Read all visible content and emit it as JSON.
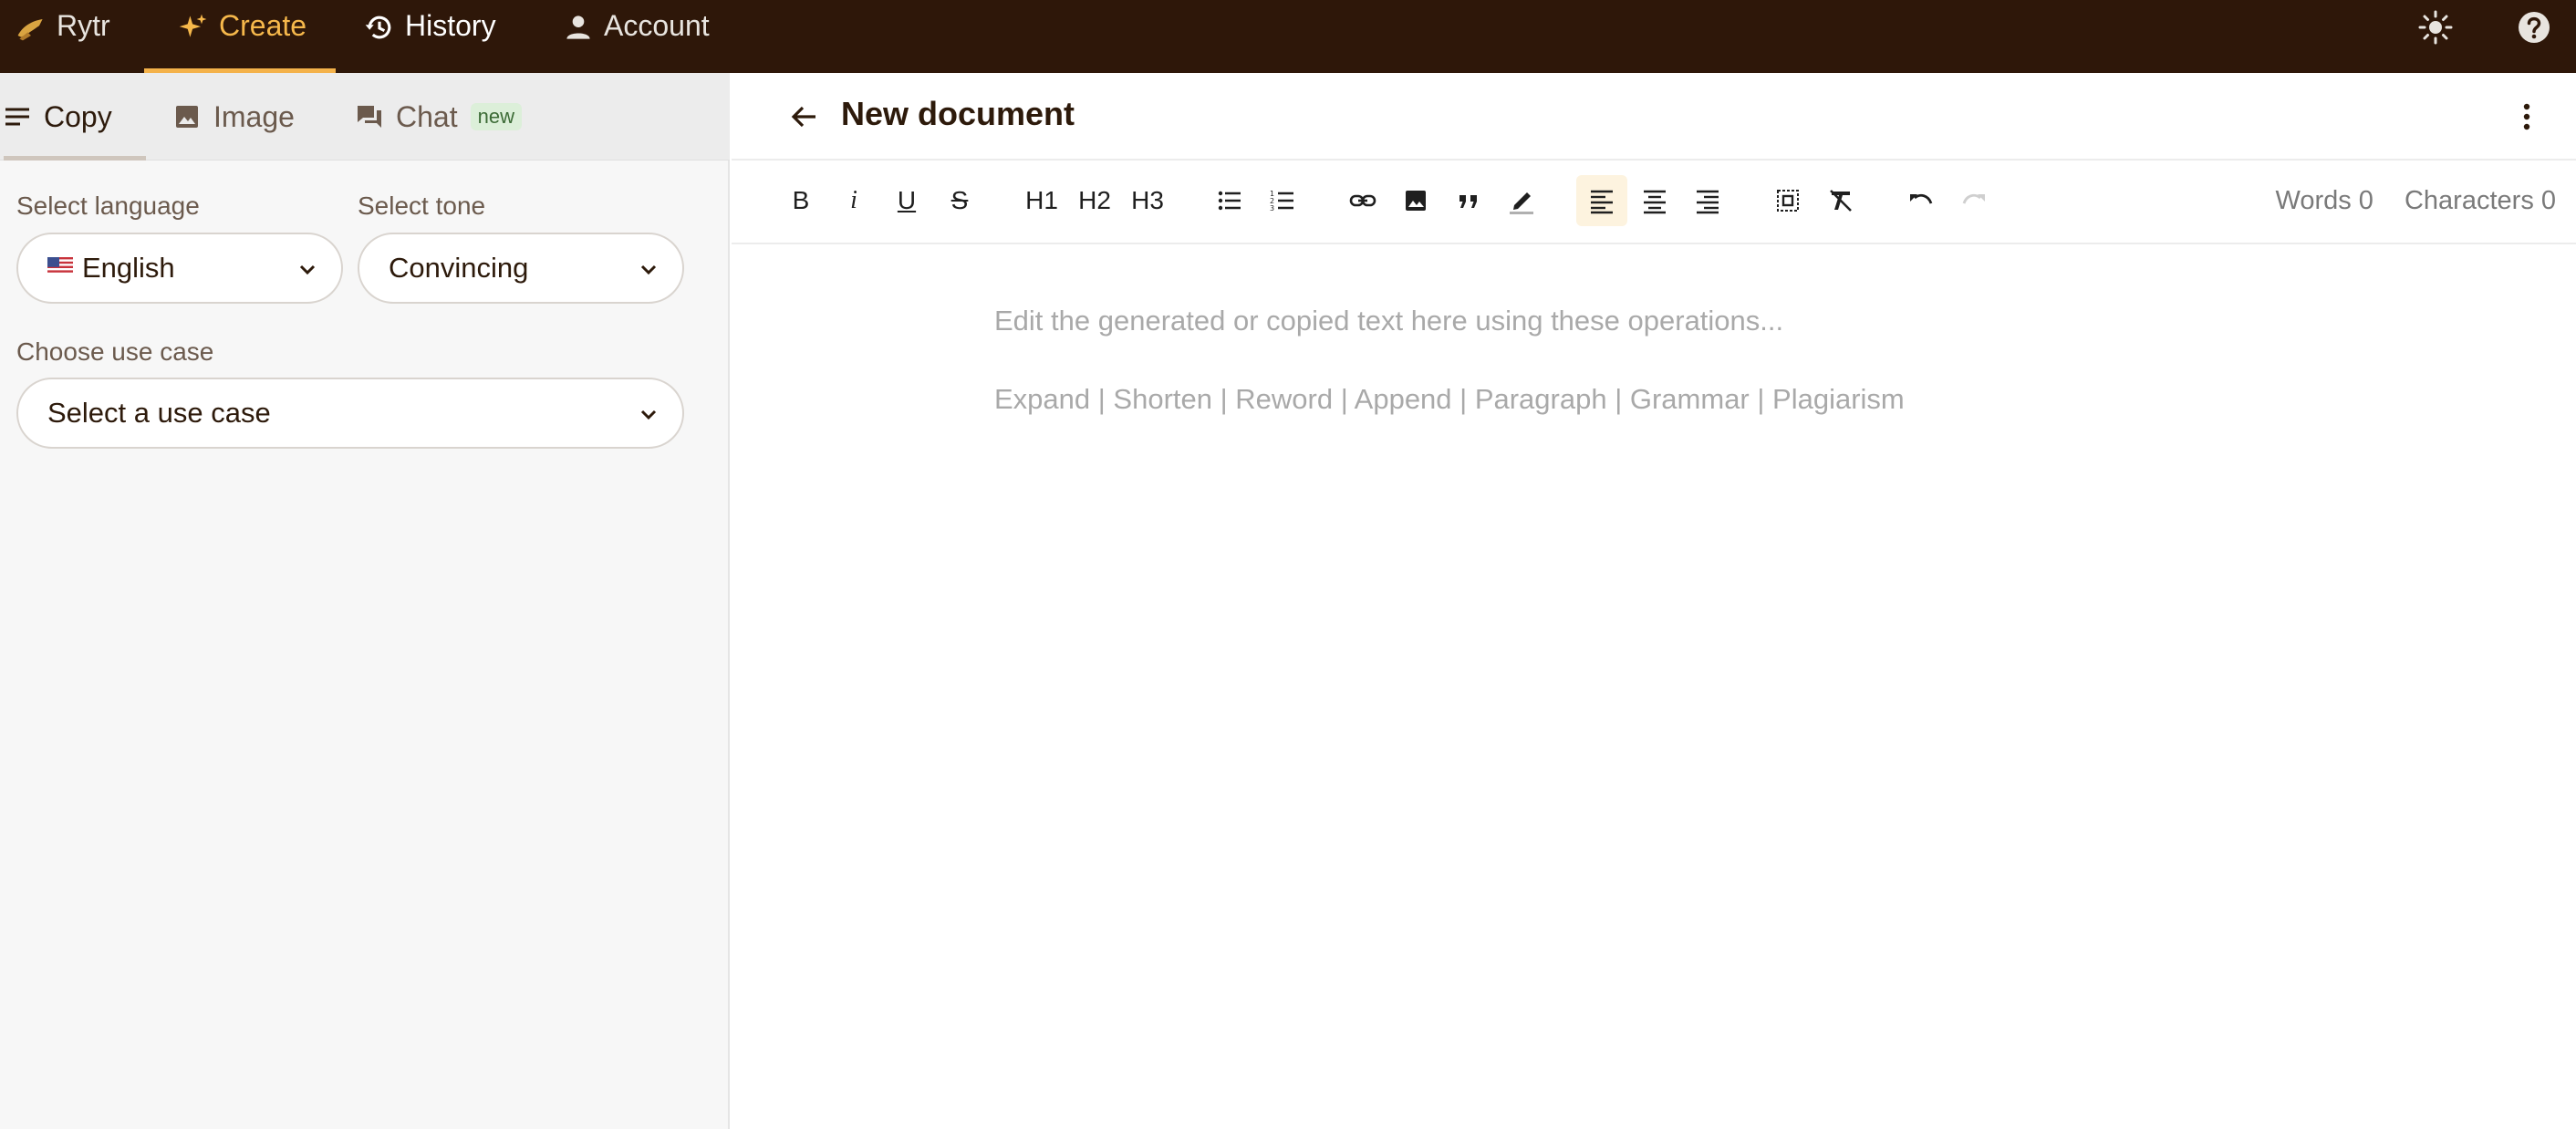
{
  "topnav": {
    "brand": "Rytr",
    "create": "Create",
    "history": "History",
    "account": "Account",
    "icons": [
      "rytr-logo-icon",
      "sparkle-icon",
      "history-icon",
      "person-icon",
      "sun-icon",
      "help-icon"
    ],
    "accent_color": "#f4b24a",
    "background_color": "#2e1709"
  },
  "left_tabs": {
    "copy": "Copy",
    "image": "Image",
    "chat": "Chat",
    "chat_badge": "new"
  },
  "form": {
    "language_label": "Select language",
    "language_value": "English",
    "tone_label": "Select tone",
    "tone_value": "Convincing",
    "usecase_label": "Choose use case",
    "usecase_value": "Select a use case"
  },
  "document": {
    "title": "New document",
    "placeholder_line1": "Edit the generated or copied text here using these operations...",
    "placeholder_line2": "Expand | Shorten | Reword | Append | Paragraph | Grammar | Plagiarism"
  },
  "toolbar": {
    "bold": "B",
    "italic": "i",
    "underline": "U",
    "strike": "S",
    "h1": "H1",
    "h2": "H2",
    "h3": "H3",
    "words_label": "Words 0",
    "characters_label": "Characters 0"
  }
}
